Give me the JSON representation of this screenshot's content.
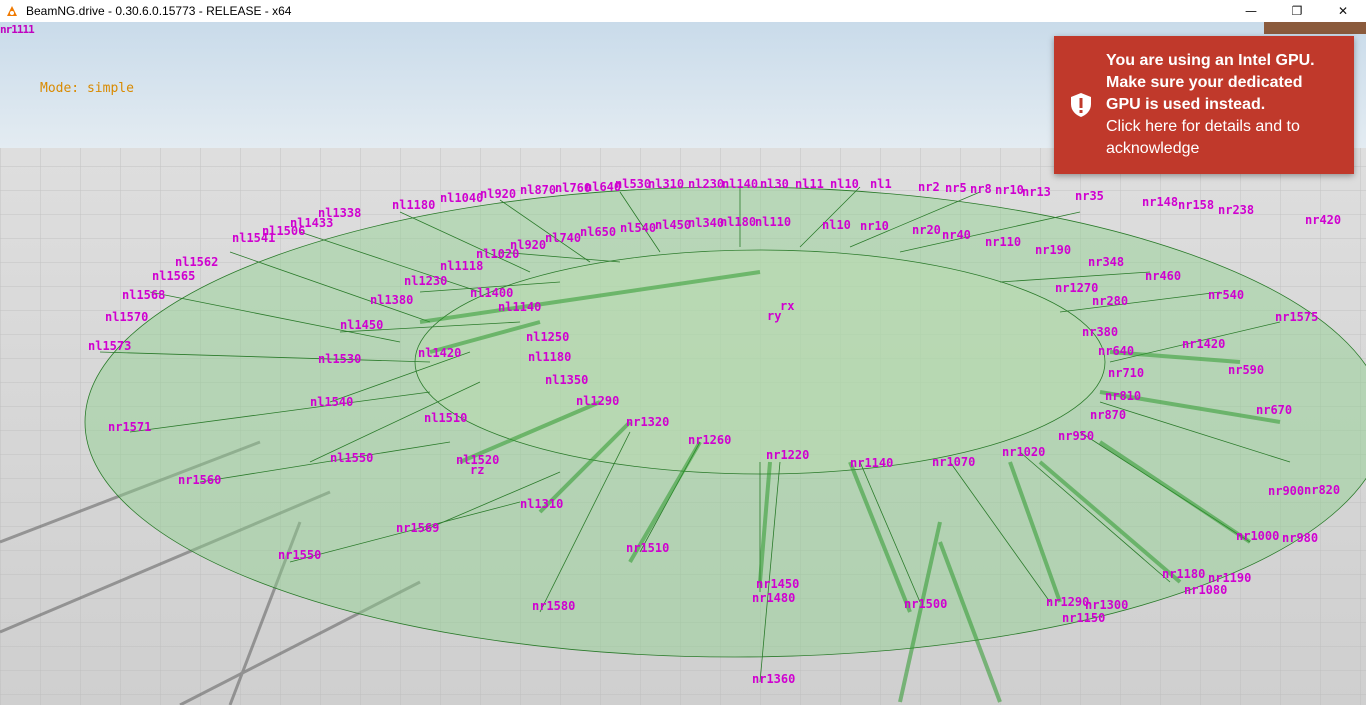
{
  "window": {
    "title": "BeamNG.drive - 0.30.6.0.15773 - RELEASE - x64",
    "app_icon": "beamng-logo-icon",
    "controls": {
      "minimize": "—",
      "maximize": "❐",
      "close": "✕"
    }
  },
  "hud": {
    "mode_text": "Mode: simple",
    "corner_debug": "nr1111"
  },
  "notification": {
    "icon": "shield-exclamation-icon",
    "line1": "You are using an Intel GPU.",
    "line2": "Make sure your dedicated",
    "line3": "GPU is used instead.",
    "line4": "Click here for details and to",
    "line5": "acknowledge",
    "background": "#c0392b"
  },
  "node_labels": [
    {
      "text": "nl1338"
    },
    {
      "text": "nl1180"
    },
    {
      "text": "nl1040"
    },
    {
      "text": "nl920"
    },
    {
      "text": "nl870"
    },
    {
      "text": "nl760"
    },
    {
      "text": "nl640"
    },
    {
      "text": "nl530"
    },
    {
      "text": "nl310"
    },
    {
      "text": "nl230"
    },
    {
      "text": "nl140"
    },
    {
      "text": "nl30"
    },
    {
      "text": "nl11"
    },
    {
      "text": "nl10"
    },
    {
      "text": "nl1"
    },
    {
      "text": "nr2"
    },
    {
      "text": "nr5"
    },
    {
      "text": "nr8"
    },
    {
      "text": "nr10"
    },
    {
      "text": "nr13"
    },
    {
      "text": "nr35"
    },
    {
      "text": "nr148"
    },
    {
      "text": "nr158"
    },
    {
      "text": "nr238"
    },
    {
      "text": "nr420"
    },
    {
      "text": "nl1433"
    },
    {
      "text": "nl1506"
    },
    {
      "text": "nl1541"
    },
    {
      "text": "nl1562"
    },
    {
      "text": "nl1565"
    },
    {
      "text": "nl1568"
    },
    {
      "text": "nl1570"
    },
    {
      "text": "nl1573"
    },
    {
      "text": "nl1020"
    },
    {
      "text": "nl1118"
    },
    {
      "text": "nl1230"
    },
    {
      "text": "nl1380"
    },
    {
      "text": "nl1450"
    },
    {
      "text": "nl1530"
    },
    {
      "text": "nl1540"
    },
    {
      "text": "nl1550"
    },
    {
      "text": "nl920"
    },
    {
      "text": "nl740"
    },
    {
      "text": "nl650"
    },
    {
      "text": "nl540"
    },
    {
      "text": "nl450"
    },
    {
      "text": "nl340"
    },
    {
      "text": "nl180"
    },
    {
      "text": "nl110"
    },
    {
      "text": "nl10"
    },
    {
      "text": "nr10"
    },
    {
      "text": "nr20"
    },
    {
      "text": "nr40"
    },
    {
      "text": "nr110"
    },
    {
      "text": "nr190"
    },
    {
      "text": "nr348"
    },
    {
      "text": "nr460"
    },
    {
      "text": "nr540"
    },
    {
      "text": "nr1575"
    },
    {
      "text": "nr1571"
    },
    {
      "text": "nr1560"
    },
    {
      "text": "nr1569"
    },
    {
      "text": "nr1550"
    },
    {
      "text": "nr1580"
    },
    {
      "text": "nr1360"
    },
    {
      "text": "nr1320"
    },
    {
      "text": "nr1260"
    },
    {
      "text": "nr1220"
    },
    {
      "text": "nr1140"
    },
    {
      "text": "nr1070"
    },
    {
      "text": "nr1020"
    },
    {
      "text": "nr950"
    },
    {
      "text": "nr870"
    },
    {
      "text": "nr810"
    },
    {
      "text": "nr710"
    },
    {
      "text": "nr640"
    },
    {
      "text": "nr380"
    },
    {
      "text": "nr280"
    },
    {
      "text": "nr1270"
    },
    {
      "text": "nr1290"
    },
    {
      "text": "nr1300"
    },
    {
      "text": "nr1150"
    },
    {
      "text": "nr1180"
    },
    {
      "text": "nr1190"
    },
    {
      "text": "nr1080"
    },
    {
      "text": "nr1000"
    },
    {
      "text": "nr980"
    },
    {
      "text": "nr900"
    },
    {
      "text": "nr820"
    },
    {
      "text": "nr670"
    },
    {
      "text": "nr590"
    },
    {
      "text": "nr1420"
    },
    {
      "text": "nr1450"
    },
    {
      "text": "nr1480"
    },
    {
      "text": "nr1500"
    },
    {
      "text": "nr1510"
    },
    {
      "text": "nl1310"
    },
    {
      "text": "nl1350"
    },
    {
      "text": "nl1290"
    },
    {
      "text": "nl1250"
    },
    {
      "text": "nl1180"
    },
    {
      "text": "nl1140"
    },
    {
      "text": "nl1400"
    },
    {
      "text": "nl1420"
    },
    {
      "text": "nl1510"
    },
    {
      "text": "nl1520"
    },
    {
      "text": "rz"
    },
    {
      "text": "rx"
    },
    {
      "text": "ry"
    }
  ]
}
